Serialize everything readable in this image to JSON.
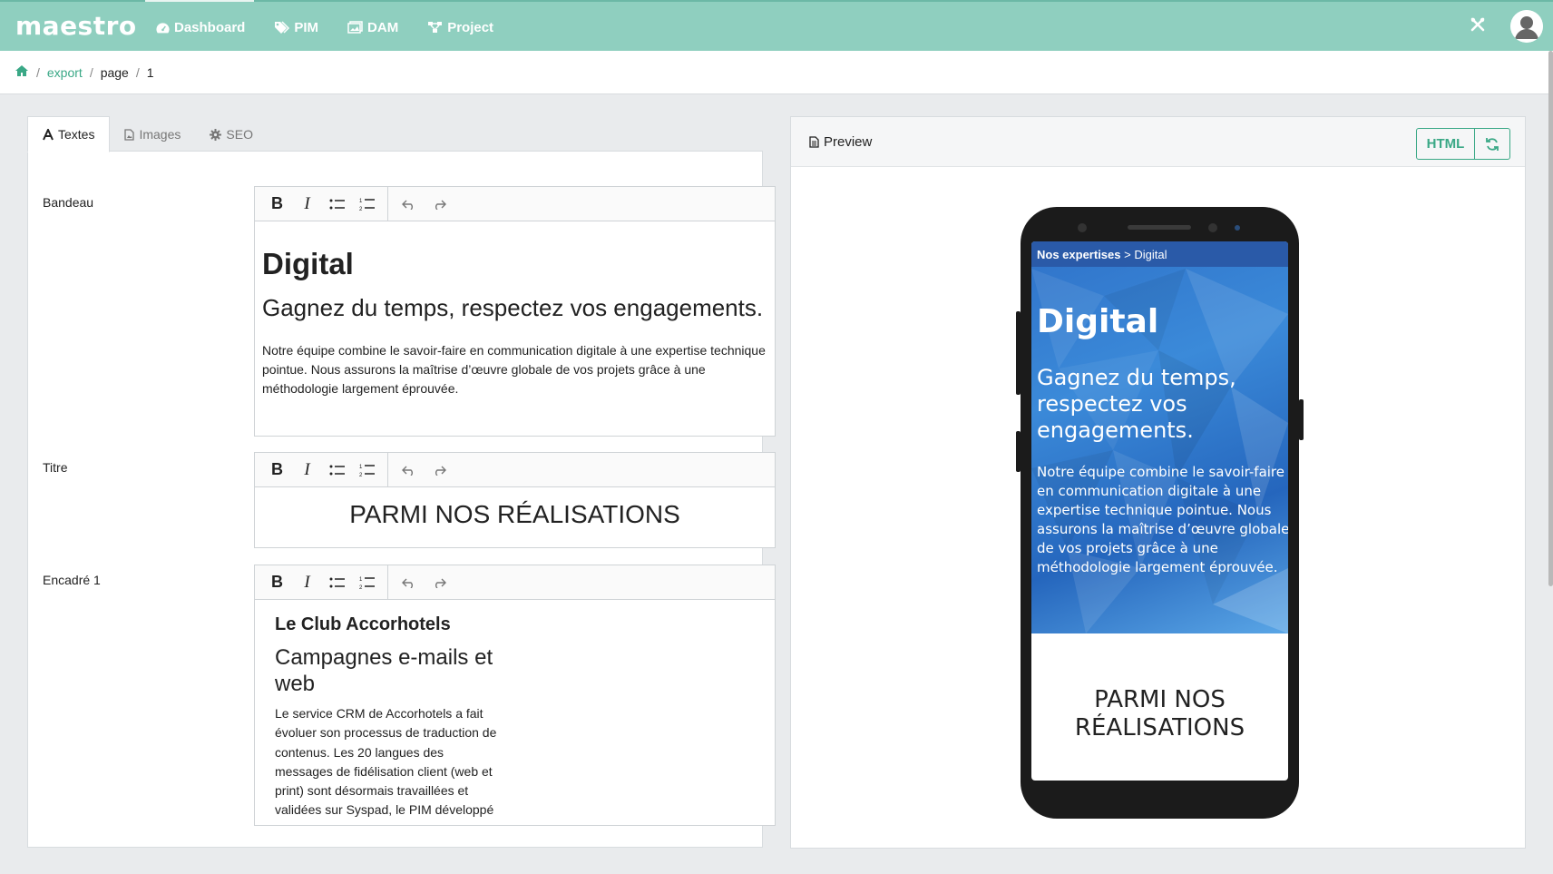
{
  "app": {
    "logo": "maestro",
    "nav": [
      {
        "label": "Dashboard",
        "icon": "dashboard-icon"
      },
      {
        "label": "PIM",
        "icon": "tags-icon"
      },
      {
        "label": "DAM",
        "icon": "images-icon"
      },
      {
        "label": "Project",
        "icon": "sitemap-icon"
      }
    ],
    "colors": {
      "header": "#8fcfbf",
      "accent": "#3aa886"
    }
  },
  "breadcrumb": {
    "home_icon": "home-icon",
    "items": [
      "export",
      "page",
      "1"
    ]
  },
  "tabs": [
    {
      "label": "Textes",
      "icon": "font-icon",
      "active": true
    },
    {
      "label": "Images",
      "icon": "file-image-icon",
      "active": false
    },
    {
      "label": "SEO",
      "icon": "gear-icon",
      "active": false
    }
  ],
  "fields": {
    "bandeau": {
      "label": "Bandeau",
      "h1": "Digital",
      "h2": "Gagnez du temps, respectez vos engagements.",
      "p": "Notre équipe combine le savoir-faire en communication digitale à une expertise technique pointue. Nous assurons la maîtrise d’œuvre globale de vos projets grâce à une méthodologie largement éprouvée."
    },
    "titre": {
      "label": "Titre",
      "text": "PARMI NOS RÉALISATIONS"
    },
    "encadre1": {
      "label": "Encadré 1",
      "h3": "Le Club Accorhotels",
      "h4": "Campagnes e-mails et web",
      "p": "Le service CRM de Accorhotels a fait évoluer son processus de traduction de contenus. Les 20 langues des messages de fidélisation client (web et print) sont désormais travaillées et validées sur Syspad, le PIM développé"
    }
  },
  "preview": {
    "title": "Preview",
    "html_button": "HTML",
    "refresh_icon": "refresh-icon",
    "phone": {
      "breadcrumb_bold": "Nos expertises",
      "breadcrumb_sep": ">",
      "breadcrumb_current": "Digital",
      "title": "Digital",
      "subtitle": "Gagnez du temps, respectez vos engagements.",
      "paragraph": "Notre équipe combine le savoir-faire en communication digitale à une expertise technique pointue. Nous assurons la maîtrise d’œuvre globale de vos projets grâce à une méthodologie largement éprouvée.",
      "section_title": "PARMI NOS RÉALISATIONS"
    }
  }
}
